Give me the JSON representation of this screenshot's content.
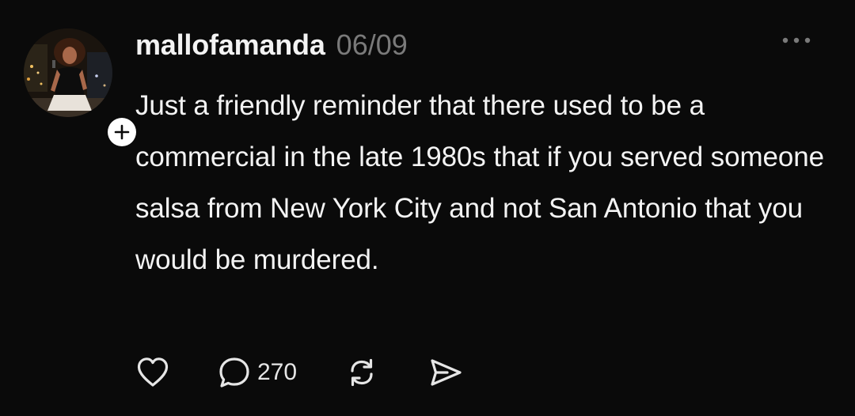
{
  "post": {
    "author": {
      "username": "mallofamanda",
      "avatar_icon": "profile-photo",
      "follow_icon": "plus-icon"
    },
    "timestamp": "06/09",
    "more_icon": "ellipsis-icon",
    "body": "Just a friendly reminder that there used to be a commercial in the late 1980s that if you served someone salsa from New York City and not San Antonio that you would be murdered.",
    "actions": {
      "like_icon": "heart-icon",
      "reply_icon": "comment-icon",
      "reply_count": "270",
      "repost_icon": "repost-icon",
      "share_icon": "send-icon"
    }
  },
  "colors": {
    "background": "#0a0a0a",
    "text": "#f3f3f3",
    "muted": "#7a7a7a"
  }
}
